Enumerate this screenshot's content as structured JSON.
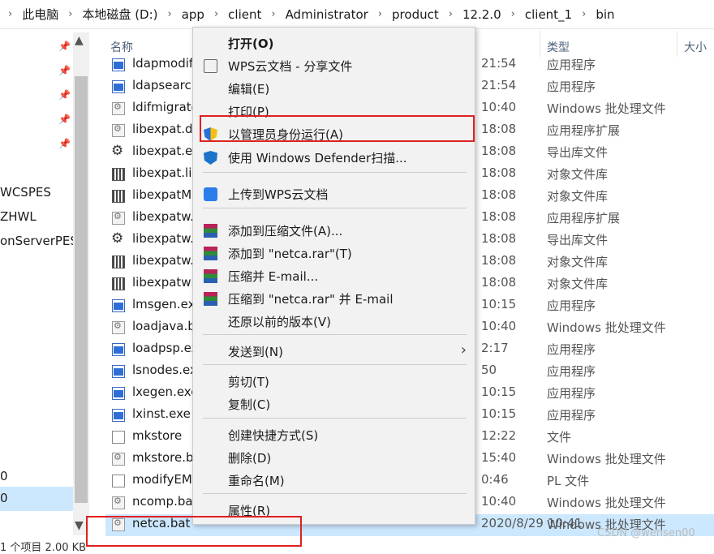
{
  "breadcrumb": [
    "此电脑",
    "本地磁盘 (D:)",
    "app",
    "client",
    "Administrator",
    "product",
    "12.2.0",
    "client_1",
    "bin"
  ],
  "nav": {
    "items": [
      "WCSPES",
      "ZHWL",
      "onServerPES"
    ],
    "extra_a": "0",
    "extra_b": "0"
  },
  "status": "1 个项目 2.00 KB",
  "headers": {
    "name": "名称",
    "type": "类型",
    "size": "大小"
  },
  "files": [
    {
      "name": "ldapmodif",
      "date": "21:54",
      "type": "应用程序",
      "icon": "exe"
    },
    {
      "name": "ldapsearch",
      "date": "21:54",
      "type": "应用程序",
      "icon": "exe"
    },
    {
      "name": "ldifmigrato",
      "date": "10:40",
      "type": "Windows 批处理文件",
      "icon": "bat"
    },
    {
      "name": "libexpat.d",
      "date": "18:08",
      "type": "应用程序扩展",
      "icon": "dll"
    },
    {
      "name": "libexpat.ex",
      "date": "18:08",
      "type": "导出库文件",
      "icon": "gear"
    },
    {
      "name": "libexpat.lil",
      "date": "18:08",
      "type": "对象文件库",
      "icon": "lib"
    },
    {
      "name": "libexpatM",
      "date": "18:08",
      "type": "对象文件库",
      "icon": "lib"
    },
    {
      "name": "libexpatw.",
      "date": "18:08",
      "type": "应用程序扩展",
      "icon": "dll"
    },
    {
      "name": "libexpatw.",
      "date": "18:08",
      "type": "导出库文件",
      "icon": "gear"
    },
    {
      "name": "libexpatw.",
      "date": "18:08",
      "type": "对象文件库",
      "icon": "lib"
    },
    {
      "name": "libexpatwl",
      "date": "18:08",
      "type": "对象文件库",
      "icon": "lib"
    },
    {
      "name": "lmsgen.ex",
      "date": "10:15",
      "type": "应用程序",
      "icon": "exe"
    },
    {
      "name": "loadjava.b",
      "date": "10:40",
      "type": "Windows 批处理文件",
      "icon": "bat"
    },
    {
      "name": "loadpsp.ex",
      "date": "2:17",
      "type": "应用程序",
      "icon": "exe"
    },
    {
      "name": "lsnodes.ex",
      "date": "50",
      "type": "应用程序",
      "icon": "exe"
    },
    {
      "name": "lxegen.exe",
      "date": "10:15",
      "type": "应用程序",
      "icon": "exe"
    },
    {
      "name": "lxinst.exe",
      "date": "10:15",
      "type": "应用程序",
      "icon": "exe"
    },
    {
      "name": "mkstore",
      "date": "12:22",
      "type": "文件",
      "icon": "file"
    },
    {
      "name": "mkstore.b",
      "date": "15:40",
      "type": "Windows 批处理文件",
      "icon": "bat"
    },
    {
      "name": "modifyEM",
      "date": "0:46",
      "type": "PL 文件",
      "icon": "file"
    },
    {
      "name": "ncomp.ba",
      "date": "10:40",
      "type": "Windows 批处理文件",
      "icon": "bat"
    },
    {
      "name": "netca.bat",
      "date": "2020/8/29 10:41",
      "type": "Windows 批处理文件",
      "icon": "bat"
    }
  ],
  "menu": {
    "open": "打开(O)",
    "wps_share": "WPS云文档 - 分享文件",
    "edit": "编辑(E)",
    "print": "打印(P)",
    "run_admin": "以管理员身份运行(A)",
    "defender": "使用 Windows Defender扫描...",
    "upload_wps": "上传到WPS云文档",
    "add_archive": "添加到压缩文件(A)...",
    "add_rar": "添加到 \"netca.rar\"(T)",
    "compress_email": "压缩并 E-mail...",
    "compress_rar_email": "压缩到 \"netca.rar\" 并 E-mail",
    "restore": "还原以前的版本(V)",
    "send_to": "发送到(N)",
    "cut": "剪切(T)",
    "copy": "复制(C)",
    "shortcut": "创建快捷方式(S)",
    "delete": "删除(D)",
    "rename": "重命名(M)",
    "properties": "属性(R)"
  },
  "watermark": "CSDN @wensen00"
}
